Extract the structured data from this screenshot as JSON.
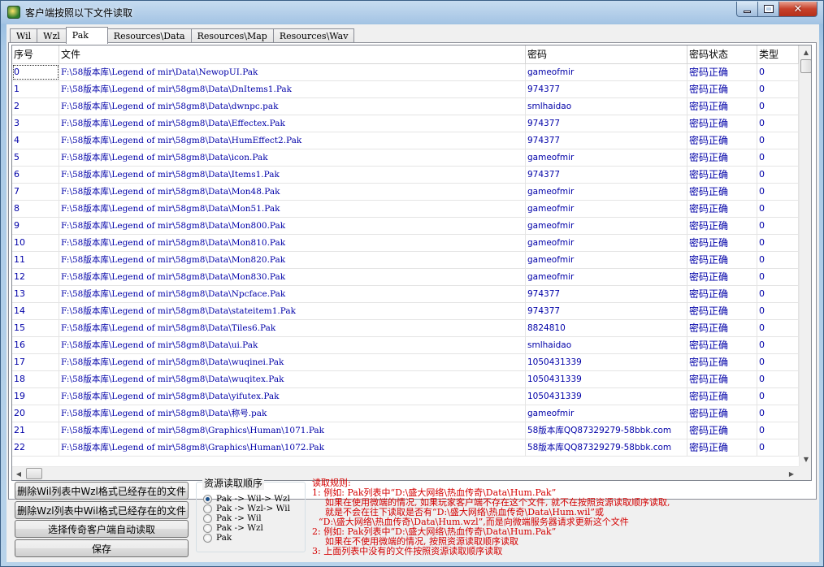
{
  "window": {
    "title": "客户端按照以下文件读取",
    "minimize_icon": "minimize-icon",
    "maximize_icon": "maximize-icon",
    "close_icon": "close-icon"
  },
  "tabs": [
    {
      "label": "Wil",
      "active": false
    },
    {
      "label": "Wzl",
      "active": false
    },
    {
      "label": "Pak",
      "active": true
    },
    {
      "label": "Resources\\Data",
      "active": false
    },
    {
      "label": "Resources\\Map",
      "active": false
    },
    {
      "label": "Resources\\Wav",
      "active": false
    }
  ],
  "table": {
    "columns": [
      "序号",
      "文件",
      "密码",
      "密码状态",
      "类型"
    ],
    "rows": [
      [
        "0",
        "F:\\58版本库\\Legend of mir\\Data\\NewopUI.Pak",
        "gameofmir",
        "密码正确",
        "0"
      ],
      [
        "1",
        "F:\\58版本库\\Legend of mir\\58gm8\\Data\\DnItems1.Pak",
        "974377",
        "密码正确",
        "0"
      ],
      [
        "2",
        "F:\\58版本库\\Legend of mir\\58gm8\\Data\\dwnpc.pak",
        "smlhaidao",
        "密码正确",
        "0"
      ],
      [
        "3",
        "F:\\58版本库\\Legend of mir\\58gm8\\Data\\Effectex.Pak",
        "974377",
        "密码正确",
        "0"
      ],
      [
        "4",
        "F:\\58版本库\\Legend of mir\\58gm8\\Data\\HumEffect2.Pak",
        "974377",
        "密码正确",
        "0"
      ],
      [
        "5",
        "F:\\58版本库\\Legend of mir\\58gm8\\Data\\icon.Pak",
        "gameofmir",
        "密码正确",
        "0"
      ],
      [
        "6",
        "F:\\58版本库\\Legend of mir\\58gm8\\Data\\Items1.Pak",
        "974377",
        "密码正确",
        "0"
      ],
      [
        "7",
        "F:\\58版本库\\Legend of mir\\58gm8\\Data\\Mon48.Pak",
        "gameofmir",
        "密码正确",
        "0"
      ],
      [
        "8",
        "F:\\58版本库\\Legend of mir\\58gm8\\Data\\Mon51.Pak",
        "gameofmir",
        "密码正确",
        "0"
      ],
      [
        "9",
        "F:\\58版本库\\Legend of mir\\58gm8\\Data\\Mon800.Pak",
        "gameofmir",
        "密码正确",
        "0"
      ],
      [
        "10",
        "F:\\58版本库\\Legend of mir\\58gm8\\Data\\Mon810.Pak",
        "gameofmir",
        "密码正确",
        "0"
      ],
      [
        "11",
        "F:\\58版本库\\Legend of mir\\58gm8\\Data\\Mon820.Pak",
        "gameofmir",
        "密码正确",
        "0"
      ],
      [
        "12",
        "F:\\58版本库\\Legend of mir\\58gm8\\Data\\Mon830.Pak",
        "gameofmir",
        "密码正确",
        "0"
      ],
      [
        "13",
        "F:\\58版本库\\Legend of mir\\58gm8\\Data\\Npcface.Pak",
        "974377",
        "密码正确",
        "0"
      ],
      [
        "14",
        "F:\\58版本库\\Legend of mir\\58gm8\\Data\\stateitem1.Pak",
        "974377",
        "密码正确",
        "0"
      ],
      [
        "15",
        "F:\\58版本库\\Legend of mir\\58gm8\\Data\\Tiles6.Pak",
        "8824810",
        "密码正确",
        "0"
      ],
      [
        "16",
        "F:\\58版本库\\Legend of mir\\58gm8\\Data\\ui.Pak",
        "smlhaidao",
        "密码正确",
        "0"
      ],
      [
        "17",
        "F:\\58版本库\\Legend of mir\\58gm8\\Data\\wuqinei.Pak",
        "1050431339",
        "密码正确",
        "0"
      ],
      [
        "18",
        "F:\\58版本库\\Legend of mir\\58gm8\\Data\\wuqitex.Pak",
        "1050431339",
        "密码正确",
        "0"
      ],
      [
        "19",
        "F:\\58版本库\\Legend of mir\\58gm8\\Data\\yifutex.Pak",
        "1050431339",
        "密码正确",
        "0"
      ],
      [
        "20",
        "F:\\58版本库\\Legend of mir\\58gm8\\Data\\称号.pak",
        "gameofmir",
        "密码正确",
        "0"
      ],
      [
        "21",
        "F:\\58版本库\\Legend of mir\\58gm8\\Graphics\\Human\\1071.Pak",
        "58版本库QQ87329279-58bbk.com",
        "密码正确",
        "0"
      ],
      [
        "22",
        "F:\\58版本库\\Legend of mir\\58gm8\\Graphics\\Human\\1072.Pak",
        "58版本库QQ87329279-58bbk.com",
        "密码正确",
        "0"
      ]
    ]
  },
  "buttons": {
    "delete_wil": "删除Wil列表中Wzl格式已经存在的文件",
    "delete_wzl": "删除Wzl列表中Wil格式已经存在的文件",
    "auto_read": "选择传奇客户端自动读取",
    "save": "保存"
  },
  "read_order": {
    "title": "资源读取顺序",
    "options": [
      {
        "label": "Pak -> Wil-> Wzl",
        "checked": true
      },
      {
        "label": "Pak -> Wzl-> Wil",
        "checked": false
      },
      {
        "label": "Pak -> Wil",
        "checked": false
      },
      {
        "label": "Pak -> Wzl",
        "checked": false
      },
      {
        "label": "Pak",
        "checked": false
      }
    ]
  },
  "rules": {
    "title": "读取规则:",
    "lines": [
      "1: 例如: Pak列表中“D:\\盛大网络\\热血传奇\\Data\\Hum.Pak”",
      "如果在使用微端的情况, 如果玩家客户端不存在这个文件, 就不在按照资源读取顺序读取,",
      "就是不会在往下读取是否有“D:\\盛大网络\\热血传奇\\Data\\Hum.wil”或",
      "“D:\\盛大网络\\热血传奇\\Data\\Hum.wzl”,而是向微端服务器请求更新这个文件",
      "2: 例如: Pak列表中“D:\\盛大网络\\热血传奇\\Data\\Hum.Pak”",
      "如果在不使用微端的情况, 按照资源读取顺序读取",
      "3: 上面列表中没有的文件按照资源读取顺序读取"
    ]
  },
  "colors": {
    "cell_text": "#0000a8",
    "rules_text": "#d40000"
  }
}
